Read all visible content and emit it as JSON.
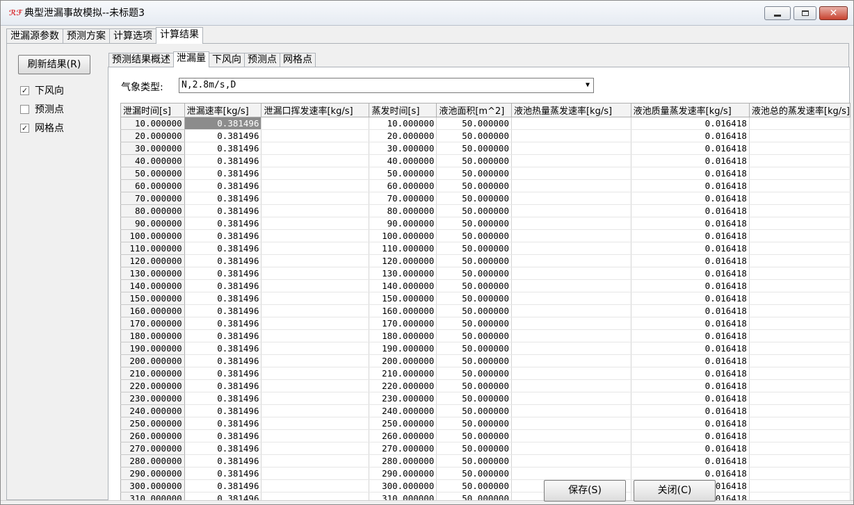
{
  "window": {
    "icon": "app-logo-icon",
    "title": "典型泄漏事故模拟--未标题3",
    "controls": {
      "minimize": "minimize-icon",
      "maximize": "maximize-icon",
      "close": "close-icon"
    }
  },
  "main_tabs": [
    {
      "label": "泄漏源参数",
      "active": false
    },
    {
      "label": "预测方案",
      "active": false
    },
    {
      "label": "计算选项",
      "active": false
    },
    {
      "label": "计算结果",
      "active": true
    }
  ],
  "left": {
    "refresh_label": "刷新结果(R)",
    "checkboxes": [
      {
        "label": "下风向",
        "checked": true
      },
      {
        "label": "预测点",
        "checked": false
      },
      {
        "label": "网格点",
        "checked": true
      }
    ]
  },
  "sub_tabs": [
    {
      "label": "预测结果概述",
      "active": false
    },
    {
      "label": "泄漏量",
      "active": true
    },
    {
      "label": "下风向",
      "active": false
    },
    {
      "label": "预测点",
      "active": false
    },
    {
      "label": "网格点",
      "active": false
    }
  ],
  "weather": {
    "label": "气象类型:",
    "value": "N,2.8m/s,D"
  },
  "table": {
    "columns": [
      "泄漏时间[s]",
      "泄漏速率[kg/s]",
      "泄漏口挥发速率[kg/s]",
      "蒸发时间[s]",
      "液池面积[m^2]",
      "液池热量蒸发速率[kg/s]",
      "液池质量蒸发速率[kg/s]",
      "液池总的蒸发速率[kg/s]"
    ],
    "rows": [
      [
        "10.000000",
        "0.381496",
        "",
        "10.000000",
        "50.000000",
        "",
        "0.016418",
        ""
      ],
      [
        "20.000000",
        "0.381496",
        "",
        "20.000000",
        "50.000000",
        "",
        "0.016418",
        ""
      ],
      [
        "30.000000",
        "0.381496",
        "",
        "30.000000",
        "50.000000",
        "",
        "0.016418",
        ""
      ],
      [
        "40.000000",
        "0.381496",
        "",
        "40.000000",
        "50.000000",
        "",
        "0.016418",
        ""
      ],
      [
        "50.000000",
        "0.381496",
        "",
        "50.000000",
        "50.000000",
        "",
        "0.016418",
        ""
      ],
      [
        "60.000000",
        "0.381496",
        "",
        "60.000000",
        "50.000000",
        "",
        "0.016418",
        ""
      ],
      [
        "70.000000",
        "0.381496",
        "",
        "70.000000",
        "50.000000",
        "",
        "0.016418",
        ""
      ],
      [
        "80.000000",
        "0.381496",
        "",
        "80.000000",
        "50.000000",
        "",
        "0.016418",
        ""
      ],
      [
        "90.000000",
        "0.381496",
        "",
        "90.000000",
        "50.000000",
        "",
        "0.016418",
        ""
      ],
      [
        "100.000000",
        "0.381496",
        "",
        "100.000000",
        "50.000000",
        "",
        "0.016418",
        ""
      ],
      [
        "110.000000",
        "0.381496",
        "",
        "110.000000",
        "50.000000",
        "",
        "0.016418",
        ""
      ],
      [
        "120.000000",
        "0.381496",
        "",
        "120.000000",
        "50.000000",
        "",
        "0.016418",
        ""
      ],
      [
        "130.000000",
        "0.381496",
        "",
        "130.000000",
        "50.000000",
        "",
        "0.016418",
        ""
      ],
      [
        "140.000000",
        "0.381496",
        "",
        "140.000000",
        "50.000000",
        "",
        "0.016418",
        ""
      ],
      [
        "150.000000",
        "0.381496",
        "",
        "150.000000",
        "50.000000",
        "",
        "0.016418",
        ""
      ],
      [
        "160.000000",
        "0.381496",
        "",
        "160.000000",
        "50.000000",
        "",
        "0.016418",
        ""
      ],
      [
        "170.000000",
        "0.381496",
        "",
        "170.000000",
        "50.000000",
        "",
        "0.016418",
        ""
      ],
      [
        "180.000000",
        "0.381496",
        "",
        "180.000000",
        "50.000000",
        "",
        "0.016418",
        ""
      ],
      [
        "190.000000",
        "0.381496",
        "",
        "190.000000",
        "50.000000",
        "",
        "0.016418",
        ""
      ],
      [
        "200.000000",
        "0.381496",
        "",
        "200.000000",
        "50.000000",
        "",
        "0.016418",
        ""
      ],
      [
        "210.000000",
        "0.381496",
        "",
        "210.000000",
        "50.000000",
        "",
        "0.016418",
        ""
      ],
      [
        "220.000000",
        "0.381496",
        "",
        "220.000000",
        "50.000000",
        "",
        "0.016418",
        ""
      ],
      [
        "230.000000",
        "0.381496",
        "",
        "230.000000",
        "50.000000",
        "",
        "0.016418",
        ""
      ],
      [
        "240.000000",
        "0.381496",
        "",
        "240.000000",
        "50.000000",
        "",
        "0.016418",
        ""
      ],
      [
        "250.000000",
        "0.381496",
        "",
        "250.000000",
        "50.000000",
        "",
        "0.016418",
        ""
      ],
      [
        "260.000000",
        "0.381496",
        "",
        "260.000000",
        "50.000000",
        "",
        "0.016418",
        ""
      ],
      [
        "270.000000",
        "0.381496",
        "",
        "270.000000",
        "50.000000",
        "",
        "0.016418",
        ""
      ],
      [
        "280.000000",
        "0.381496",
        "",
        "280.000000",
        "50.000000",
        "",
        "0.016418",
        ""
      ],
      [
        "290.000000",
        "0.381496",
        "",
        "290.000000",
        "50.000000",
        "",
        "0.016418",
        ""
      ],
      [
        "300.000000",
        "0.381496",
        "",
        "300.000000",
        "50.000000",
        "",
        "0.016418",
        ""
      ],
      [
        "310.000000",
        "0.381496",
        "",
        "310.000000",
        "50.000000",
        "",
        "0.016418",
        ""
      ]
    ]
  },
  "buttons": {
    "save": "保存(S)",
    "close": "关闭(C)"
  }
}
